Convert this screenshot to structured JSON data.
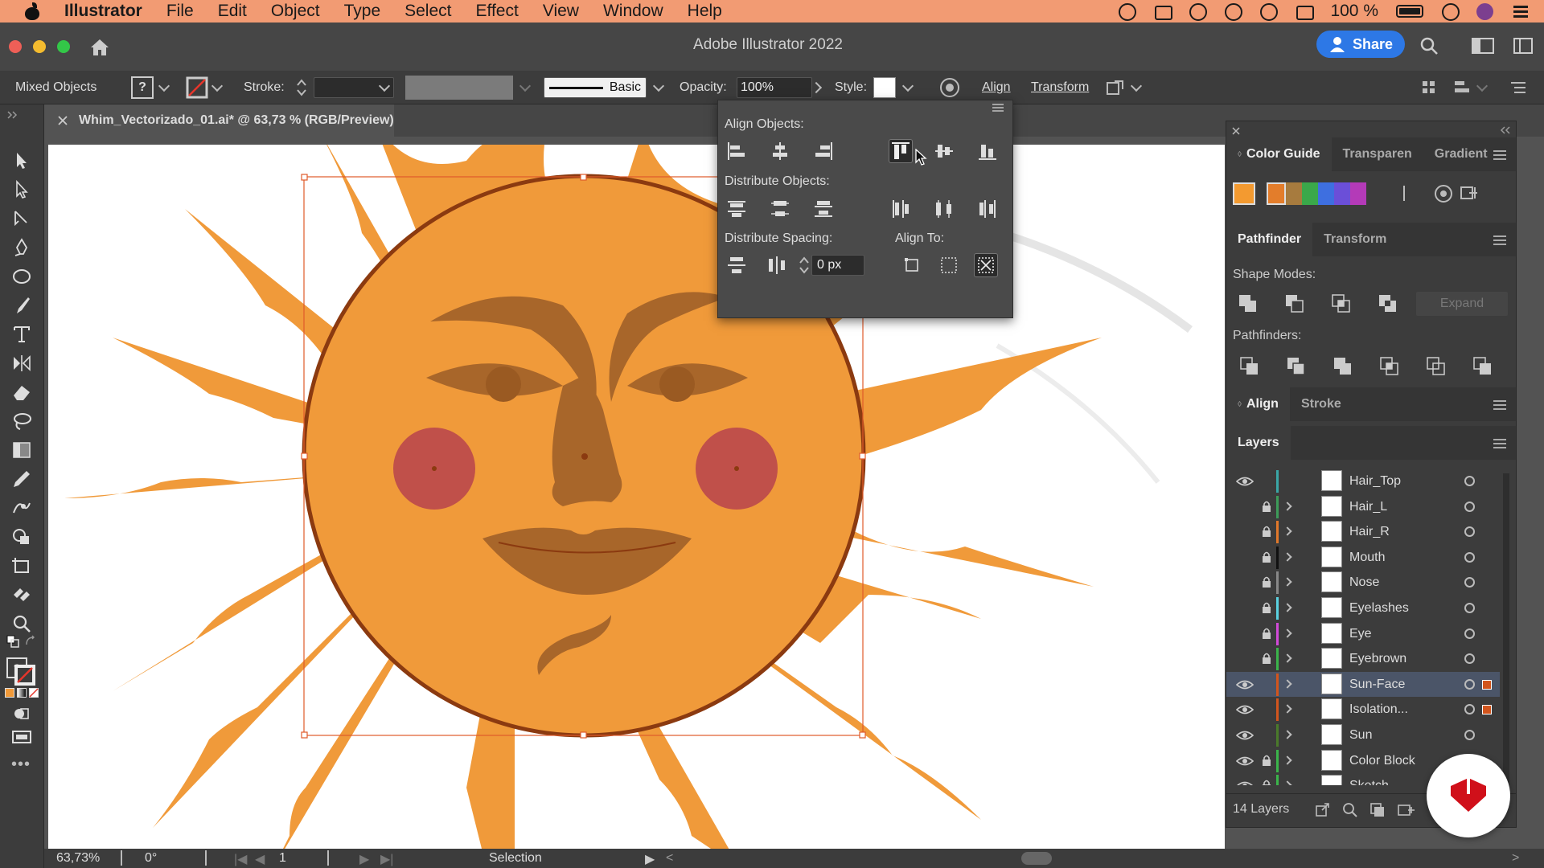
{
  "menubar": {
    "app": "Illustrator",
    "items": [
      "File",
      "Edit",
      "Object",
      "Type",
      "Select",
      "Effect",
      "View",
      "Window",
      "Help"
    ],
    "battery": "100 %"
  },
  "titlebar": {
    "title": "Adobe Illustrator 2022",
    "share_label": "Share"
  },
  "controlbar": {
    "selection_type": "Mixed Objects",
    "stroke_label": "Stroke:",
    "brush_label": "Basic",
    "opacity_label": "Opacity:",
    "opacity_value": "100%",
    "style_label": "Style:",
    "align_label": "Align",
    "transform_label": "Transform"
  },
  "document": {
    "tab_title": "Whim_Vectorizado_01.ai* @ 63,73 % (RGB/Preview)"
  },
  "align_popup": {
    "align_objects_label": "Align Objects:",
    "distribute_objects_label": "Distribute Objects:",
    "distribute_spacing_label": "Distribute Spacing:",
    "align_to_label": "Align To:",
    "spacing_value": "0 px"
  },
  "panels": {
    "top_tabs": [
      "Color Guide",
      "Transparen",
      "Gradient"
    ],
    "mid_tabs": [
      "Pathfinder",
      "Transform"
    ],
    "shape_modes_label": "Shape Modes:",
    "expand_label": "Expand",
    "pathfinders_label": "Pathfinders:",
    "align_tabs": [
      "Align",
      "Stroke"
    ],
    "layers_title": "Layers",
    "layers_count": "14 Layers",
    "swatch_colors": [
      "#f39a30",
      "#e37d2b",
      "#a77b3e",
      "#3aa84a",
      "#3e6fe0",
      "#6b4fd8",
      "#b43ab8"
    ]
  },
  "layers": [
    {
      "name": "Hair_Top",
      "visible": true,
      "locked": false,
      "color": "#3aa7a7",
      "expandable": false,
      "selected": false,
      "target": false
    },
    {
      "name": "Hair_L",
      "visible": false,
      "locked": true,
      "color": "#3d9b59",
      "expandable": true,
      "selected": false,
      "target": false
    },
    {
      "name": "Hair_R",
      "visible": false,
      "locked": true,
      "color": "#e0782a",
      "expandable": true,
      "selected": false,
      "target": false
    },
    {
      "name": "Mouth",
      "visible": false,
      "locked": true,
      "color": "#111111",
      "expandable": true,
      "selected": false,
      "target": false
    },
    {
      "name": "Nose",
      "visible": false,
      "locked": true,
      "color": "#888888",
      "expandable": true,
      "selected": false,
      "target": false
    },
    {
      "name": "Eyelashes",
      "visible": false,
      "locked": true,
      "color": "#5ad1e0",
      "expandable": true,
      "selected": false,
      "target": false
    },
    {
      "name": "Eye",
      "visible": false,
      "locked": true,
      "color": "#d24ad8",
      "expandable": true,
      "selected": false,
      "target": false
    },
    {
      "name": "Eyebrown",
      "visible": false,
      "locked": true,
      "color": "#3bb44a",
      "expandable": true,
      "selected": false,
      "target": false
    },
    {
      "name": "Sun-Face",
      "visible": true,
      "locked": false,
      "color": "#d2551d",
      "expandable": true,
      "selected": true,
      "target": true
    },
    {
      "name": "Isolation...",
      "visible": true,
      "locked": false,
      "color": "#d2551d",
      "expandable": true,
      "selected": false,
      "target": true
    },
    {
      "name": "Sun",
      "visible": true,
      "locked": false,
      "color": "#4a7a2a",
      "expandable": true,
      "selected": false,
      "target": false
    },
    {
      "name": "Color Block",
      "visible": true,
      "locked": true,
      "color": "#3bb44a",
      "expandable": true,
      "selected": false,
      "target": false
    },
    {
      "name": "Sketch",
      "visible": true,
      "locked": true,
      "color": "#3bb44a",
      "expandable": true,
      "selected": false,
      "target": false
    }
  ],
  "statusbar": {
    "zoom": "63,73%",
    "rotation": "0°",
    "artboard": "1",
    "mode": "Selection"
  },
  "artwork": {
    "sun_color": "#f09a3a",
    "face_line_color": "#8b3a10",
    "feature_color": "#a8662a",
    "cheek_color": "#c0504a"
  }
}
